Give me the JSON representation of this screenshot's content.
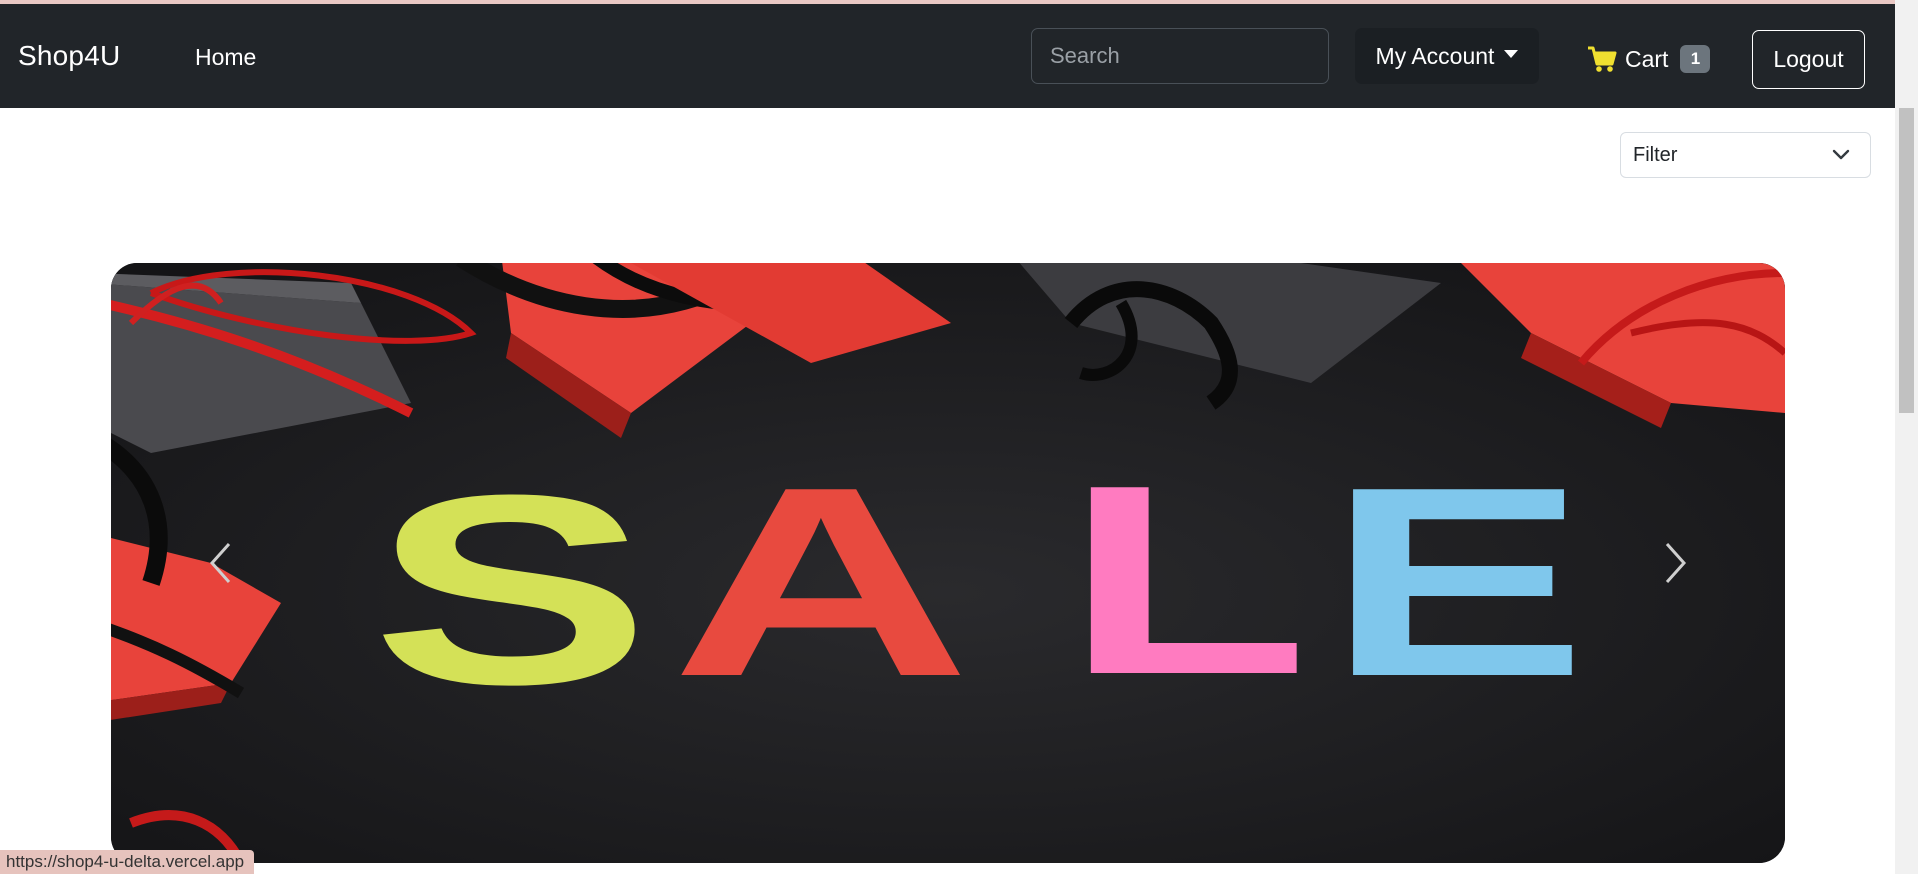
{
  "navbar": {
    "brand": "Shop4U",
    "home_label": "Home",
    "search_placeholder": "Search",
    "account_label": "My Account",
    "cart_label": "Cart",
    "cart_count": "1",
    "logout_label": "Logout"
  },
  "filter": {
    "selected": "Filter"
  },
  "carousel": {
    "banner_text": "SALE",
    "letter_colors": [
      "#d4e157",
      "#e84a3f",
      "#ff7bc0",
      "#7fc7ec"
    ]
  },
  "status_bar": {
    "url": "https://shop4-u-delta.vercel.app"
  },
  "colors": {
    "navbar_bg": "#212529",
    "cart_icon": "#f0e030",
    "badge_bg": "#6c757d"
  }
}
